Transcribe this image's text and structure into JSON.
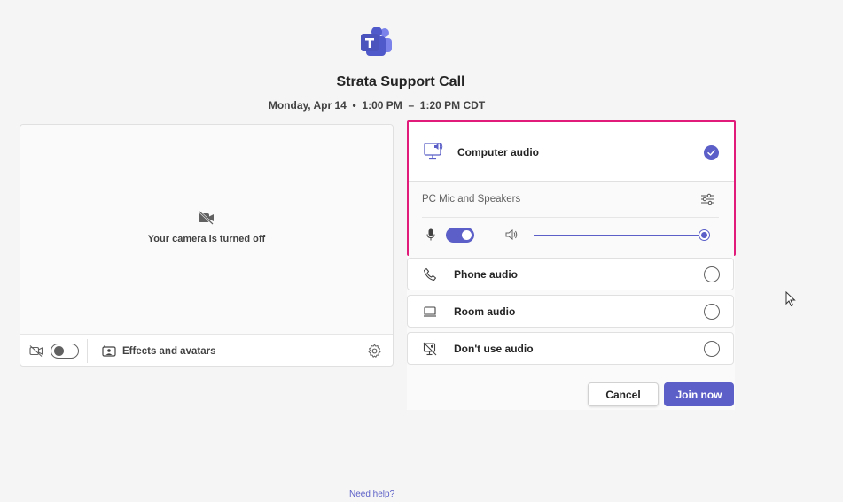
{
  "meeting": {
    "title": "Strata Support Call",
    "date": "Monday, Apr 14",
    "separator": "•",
    "start": "1:00 PM",
    "dash": "–",
    "end": "1:20 PM CDT"
  },
  "camera": {
    "off_message": "Your camera is turned off",
    "effects_label": "Effects and avatars",
    "camera_toggle": "off"
  },
  "audio": {
    "computer_audio": {
      "label": "Computer audio",
      "selected": true,
      "device_label": "PC Mic and Speakers",
      "mic_enabled": true,
      "speaker_volume": 0.97
    },
    "options": [
      {
        "label": "Phone audio",
        "icon": "phone-icon",
        "selected": false
      },
      {
        "label": "Room audio",
        "icon": "room-device-icon",
        "selected": false
      },
      {
        "label": "Don't use audio",
        "icon": "no-audio-icon",
        "selected": false
      }
    ]
  },
  "actions": {
    "cancel_label": "Cancel",
    "join_label": "Join now"
  },
  "footer": {
    "help_link": "Need help?"
  },
  "colors": {
    "accent": "#5b5fc7",
    "highlight_border": "#e01b7a",
    "background": "#f5f5f5"
  }
}
